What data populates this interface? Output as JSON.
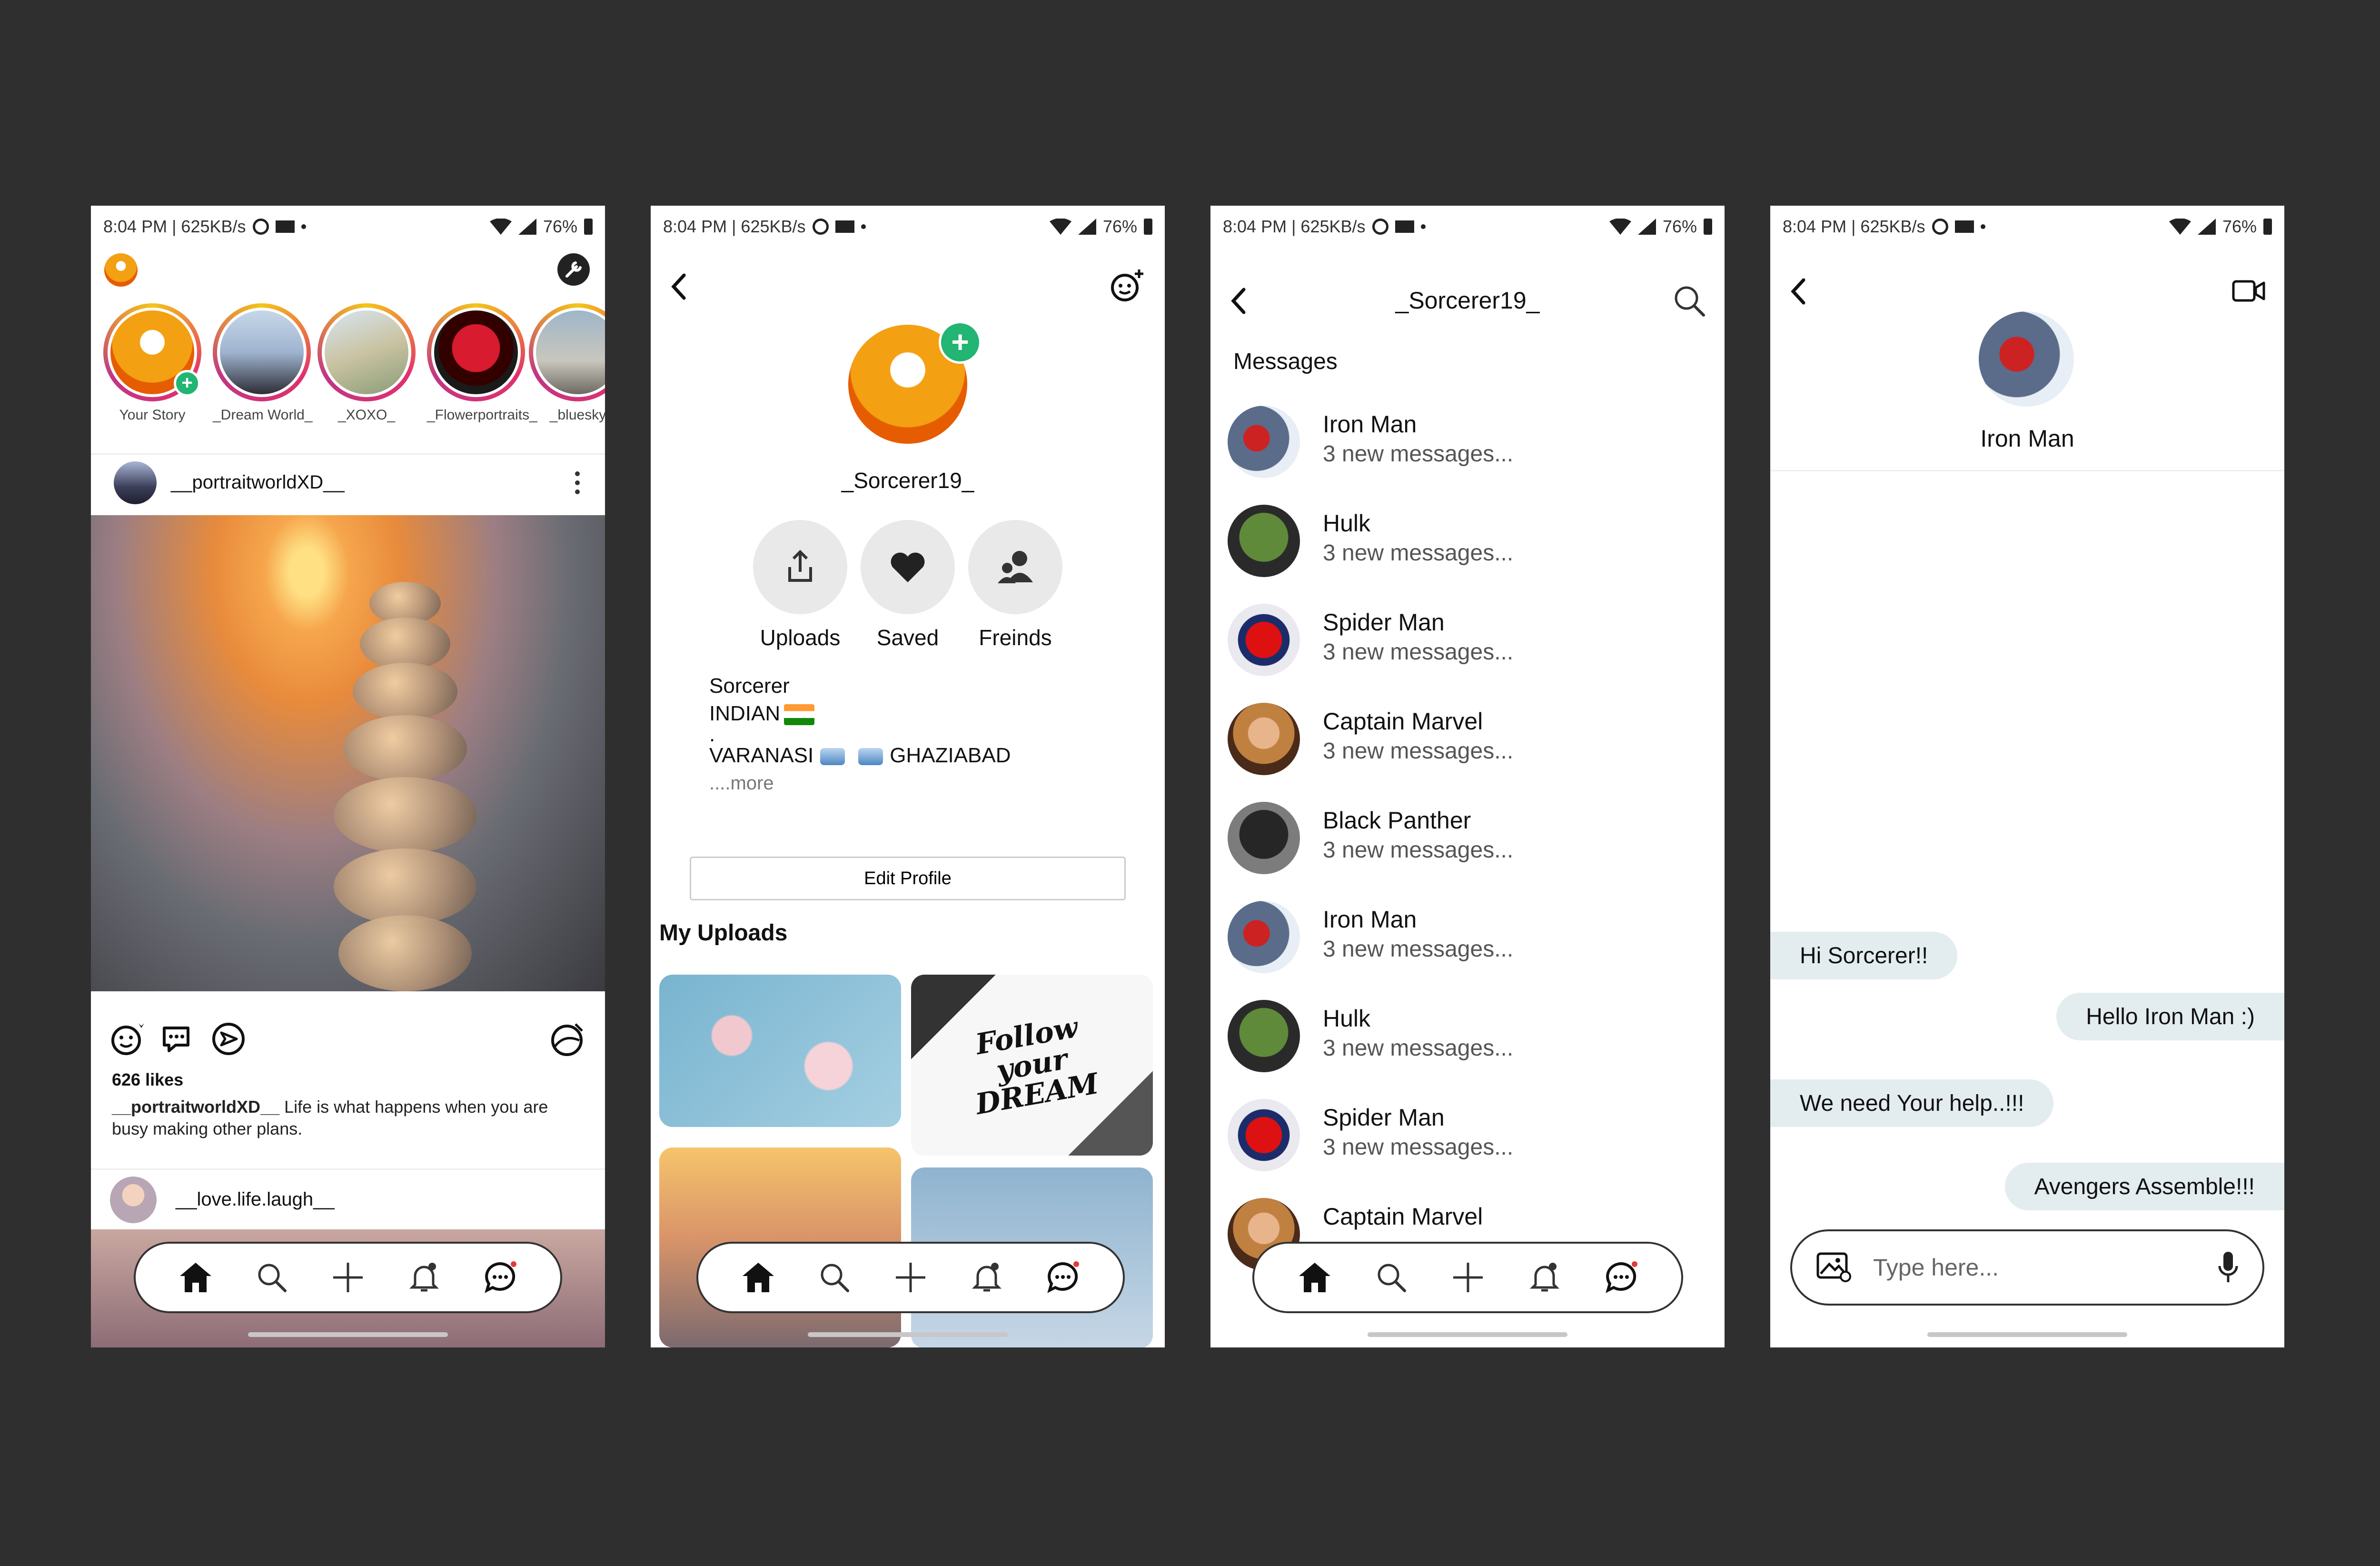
{
  "status": {
    "time": "8:04 PM | 625KB/s",
    "battery": "76%"
  },
  "feed": {
    "stories": [
      {
        "label": "Your Story",
        "avatar": "g-sorc",
        "own": true
      },
      {
        "label": "_Dream World_",
        "avatar": "g-dream"
      },
      {
        "label": "_XOXO_",
        "avatar": "g-xoxo"
      },
      {
        "label": "_Flowerportraits_",
        "avatar": "g-flower"
      },
      {
        "label": "_bluesky",
        "avatar": "g-blue"
      }
    ],
    "post": {
      "user": "__portraitworldXD__",
      "likes": "626 likes",
      "caption_user": "__portraitworldXD__",
      "caption_text": " Life is what happens when you are busy making other plans."
    },
    "next_post_user": "__love.life.laugh__"
  },
  "profile": {
    "username": "_Sorcerer19_",
    "buttons": [
      "Uploads",
      "Saved",
      "Freinds"
    ],
    "bio_line1": "Sorcerer",
    "bio_line2": "INDIAN",
    "bio_dot": ".",
    "bio_city1": "VARANASI",
    "bio_city2": "GHAZIABAD",
    "bio_more": "....more",
    "edit_label": "Edit Profile",
    "uploads_heading": "My Uploads",
    "dream_text": "Follow your DREAM"
  },
  "messages": {
    "title": "_Sorcerer19_",
    "heading": "Messages",
    "items": [
      {
        "name": "Iron Man",
        "preview": "3 new messages...",
        "avatar": "g-iron"
      },
      {
        "name": "Hulk",
        "preview": "3 new messages...",
        "avatar": "g-hulk"
      },
      {
        "name": "Spider Man",
        "preview": "3 new messages...",
        "avatar": "g-spider"
      },
      {
        "name": "Captain Marvel",
        "preview": "3 new messages...",
        "avatar": "g-cap"
      },
      {
        "name": "Black Panther",
        "preview": "3 new messages...",
        "avatar": "g-panther"
      },
      {
        "name": "Iron Man",
        "preview": "3 new messages...",
        "avatar": "g-iron"
      },
      {
        "name": "Hulk",
        "preview": "3 new messages...",
        "avatar": "g-hulk"
      },
      {
        "name": "Spider Man",
        "preview": "3 new messages...",
        "avatar": "g-spider"
      },
      {
        "name": "Captain Marvel",
        "preview": "",
        "avatar": "g-cap"
      }
    ]
  },
  "chat": {
    "contact": "Iron Man",
    "bubbles": [
      {
        "text": "Hi Sorcerer!!",
        "side": "left"
      },
      {
        "text": "Hello Iron Man :)",
        "side": "right"
      },
      {
        "text": "We need Your help..!!!",
        "side": "left"
      },
      {
        "text": "Avengers Assemble!!!",
        "side": "right"
      }
    ],
    "placeholder": "Type here..."
  },
  "icons": [
    "home-icon",
    "search-icon",
    "add-icon",
    "bell-icon",
    "chat-icon",
    "back-icon",
    "video-icon",
    "mic-icon",
    "image-icon",
    "settings-icon"
  ]
}
